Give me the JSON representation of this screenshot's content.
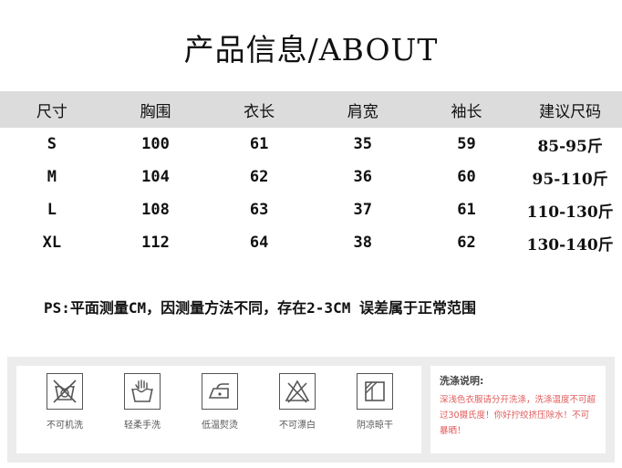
{
  "title": "产品信息/ABOUT",
  "table": {
    "headers": [
      "尺寸",
      "胸围",
      "衣长",
      "肩宽",
      "袖长",
      "建议尺码"
    ],
    "rows": [
      [
        "S",
        "100",
        "61",
        "35",
        "59",
        "85-95斤"
      ],
      [
        "M",
        "104",
        "62",
        "36",
        "60",
        "95-110斤"
      ],
      [
        "L",
        "108",
        "63",
        "37",
        "61",
        "110-130斤"
      ],
      [
        "XL",
        "112",
        "64",
        "38",
        "62",
        "130-140斤"
      ]
    ]
  },
  "ps_note": "PS:平面测量CM，因测量方法不同，存在2-3CM 误差属于正常范围",
  "care": {
    "icons": [
      {
        "icon": "no-machine-wash-icon",
        "label": "不可机洗"
      },
      {
        "icon": "gentle-hand-wash-icon",
        "label": "轻柔手洗"
      },
      {
        "icon": "low-temp-iron-icon",
        "label": "低温熨烫"
      },
      {
        "icon": "no-bleach-icon",
        "label": "不可漂白"
      },
      {
        "icon": "shade-dry-icon",
        "label": "阴凉晾干"
      }
    ],
    "note_title": "洗涤说明:",
    "note_text": "深浅色衣服请分开洗涤，洗涤温度不可超过30摄氏度！你好拧绞挤压除水！不可暴晒！"
  },
  "colors": {
    "header_bg": "#dcdcdc",
    "panel_bg": "#ececec",
    "note_text": "#e05a5a"
  }
}
